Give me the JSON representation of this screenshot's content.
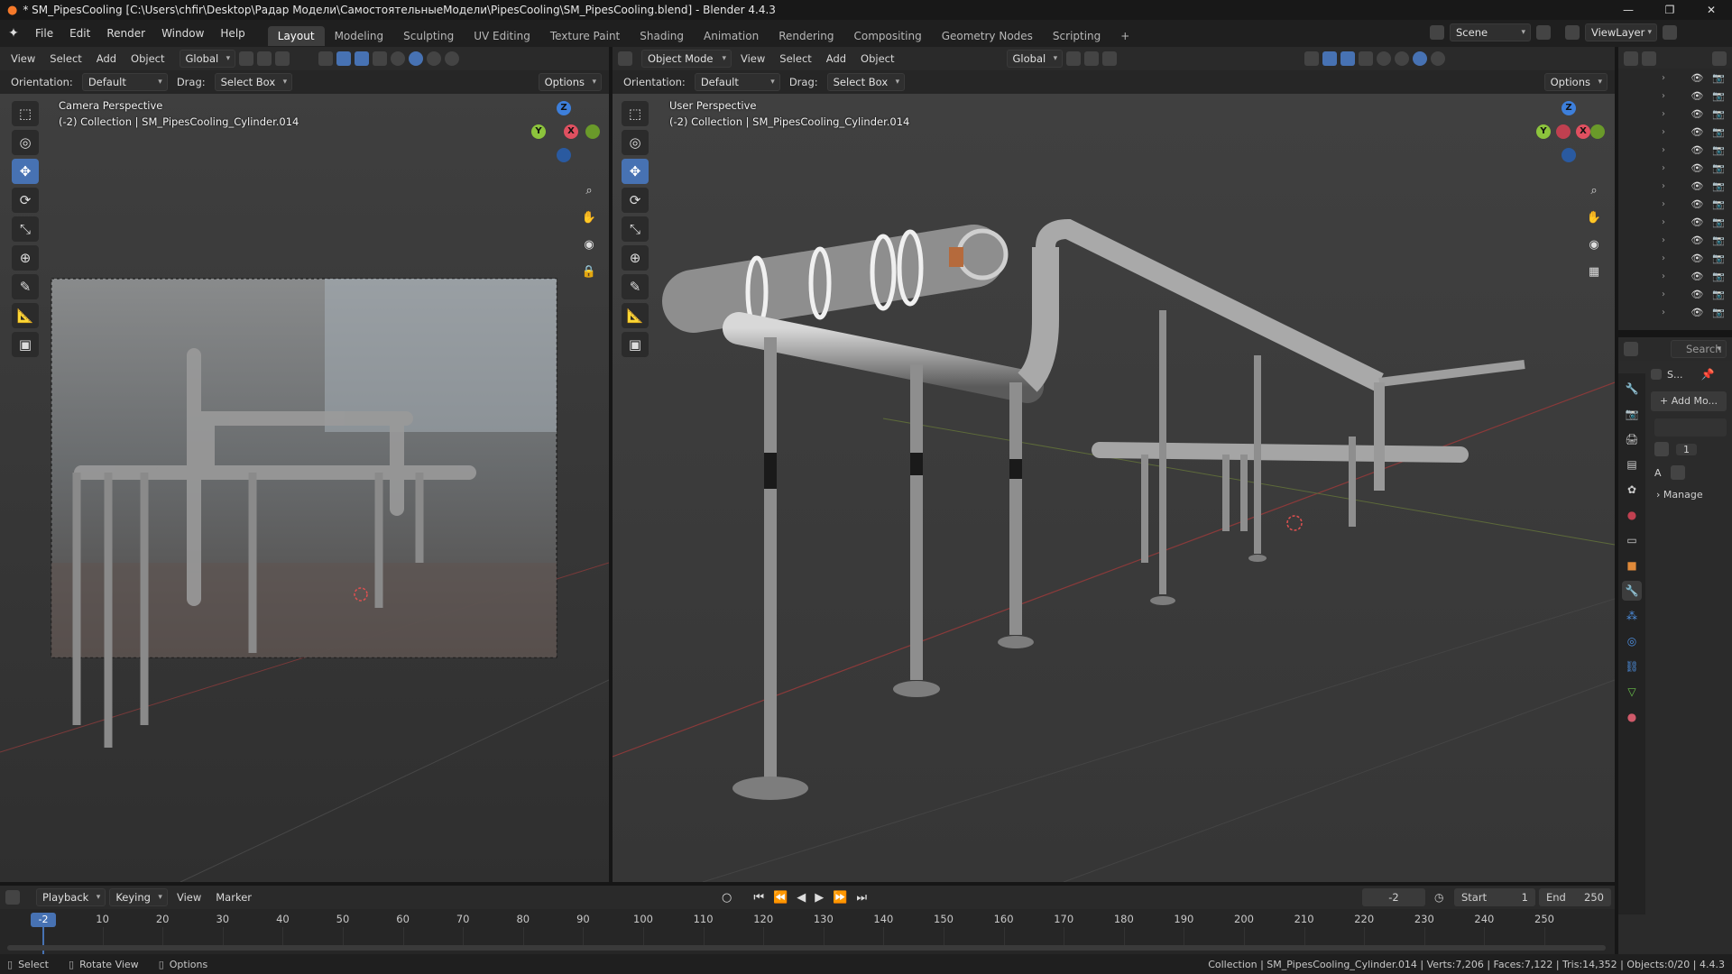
{
  "window": {
    "title": "* SM_PipesCooling [C:\\Users\\chfir\\Desktop\\Радар Модели\\СамостоятельныеМодели\\PipesCooling\\SM_PipesCooling.blend] - Blender 4.4.3",
    "controls": [
      "—",
      "❐",
      "✕"
    ]
  },
  "menubar": {
    "menus": [
      "File",
      "Edit",
      "Render",
      "Window",
      "Help"
    ],
    "workspaces": [
      "Layout",
      "Modeling",
      "Sculpting",
      "UV Editing",
      "Texture Paint",
      "Shading",
      "Animation",
      "Rendering",
      "Compositing",
      "Geometry Nodes",
      "Scripting"
    ],
    "active_workspace": "Layout",
    "add_tab": "+",
    "scene_label": "Scene",
    "viewlayer_label": "ViewLayer"
  },
  "left_viewport": {
    "menus": [
      "View",
      "Select",
      "Add",
      "Object"
    ],
    "transform": "Global",
    "orientation_label": "Orientation:",
    "orientation_value": "Default",
    "drag_label": "Drag:",
    "drag_value": "Select Box",
    "options": "Options",
    "view_name": "Camera Perspective",
    "collection_line": "(-2) Collection | SM_PipesCooling_Cylinder.014"
  },
  "right_viewport": {
    "mode": "Object Mode",
    "menus": [
      "View",
      "Select",
      "Add",
      "Object"
    ],
    "transform": "Global",
    "orientation_label": "Orientation:",
    "orientation_value": "Default",
    "drag_label": "Drag:",
    "drag_value": "Select Box",
    "options": "Options",
    "view_name": "User Perspective",
    "collection_line": "(-2) Collection | SM_PipesCooling_Cylinder.014"
  },
  "gizmo": {
    "z": "Z",
    "y": "Y",
    "x": "X"
  },
  "properties": {
    "search_placeholder": "Search",
    "object_short": "S...",
    "add_modifier": "+ Add Mo...",
    "manage": "Manage",
    "field_a": "A",
    "field_num": "1"
  },
  "timeline": {
    "menus": [
      "Playback",
      "Keying",
      "View",
      "Marker"
    ],
    "current_frame": "-2",
    "start_label": "Start",
    "start_value": "1",
    "end_label": "End",
    "end_value": "250",
    "ticks": [
      "10",
      "20",
      "30",
      "40",
      "50",
      "60",
      "70",
      "80",
      "90",
      "100",
      "110",
      "120",
      "130",
      "140",
      "150",
      "160",
      "170",
      "180",
      "190",
      "200",
      "210",
      "220",
      "230",
      "240",
      "250"
    ]
  },
  "statusbar": {
    "select": "Select",
    "rotate": "Rotate View",
    "options": "Options",
    "stats": "Collection | SM_PipesCooling_Cylinder.014 | Verts:7,206 | Faces:7,122 | Tris:14,352 | Objects:0/20 | 4.4.3"
  },
  "colors": {
    "accent": "#4772b3",
    "axis_x": "#e05060",
    "axis_y": "#8cc43c",
    "axis_z": "#3d7fdb"
  }
}
